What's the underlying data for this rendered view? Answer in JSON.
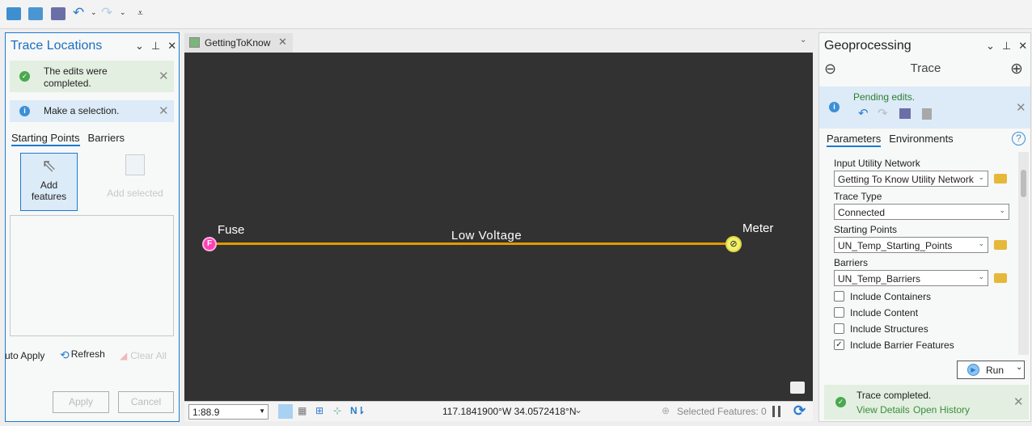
{
  "toolbar": {
    "icons": [
      "new-project-icon",
      "open-project-icon",
      "save-project-icon",
      "undo-icon",
      "redo-icon",
      "customize-icon"
    ]
  },
  "left_panel": {
    "title": "Trace Locations",
    "success_msg_line1": "The edits were",
    "success_msg_line2": "completed.",
    "info_msg": "Make a selection.",
    "tabs": [
      "Starting Points",
      "Barriers"
    ],
    "add_features_line1": "Add",
    "add_features_line2": "features",
    "add_selected": "Add selected",
    "auto_apply": "Auto Apply",
    "refresh": "Refresh",
    "clear_all": "Clear All",
    "apply": "Apply",
    "cancel": "Cancel"
  },
  "map": {
    "tab_label": "GettingToKnow",
    "fuse_label": "Fuse",
    "fuse_symbol": "F",
    "line_label": "Low Voltage",
    "meter_label": "Meter",
    "line_color": "#e39a00",
    "scale": "1:88.9",
    "coordinates": "117.1841900°W 34.0572418°N",
    "selected_features": "Selected Features: 0"
  },
  "right_panel": {
    "title": "Geoprocessing",
    "tool": "Trace",
    "pending": "Pending edits.",
    "tabs": [
      "Parameters",
      "Environments"
    ],
    "fields": [
      {
        "label": "Input Utility Network",
        "value": "Getting To Know Utility Network"
      },
      {
        "label": "Trace Type",
        "value": "Connected"
      },
      {
        "label": "Starting Points",
        "value": "UN_Temp_Starting_Points"
      },
      {
        "label": "Barriers",
        "value": "UN_Temp_Barriers"
      }
    ],
    "checkboxes": [
      {
        "label": "Include Containers",
        "checked": false
      },
      {
        "label": "Include Content",
        "checked": false
      },
      {
        "label": "Include Structures",
        "checked": false
      },
      {
        "label": "Include Barrier Features",
        "checked": true
      }
    ],
    "run": "Run",
    "completed": "Trace completed.",
    "view_details": "View Details",
    "open_history": "Open History"
  }
}
